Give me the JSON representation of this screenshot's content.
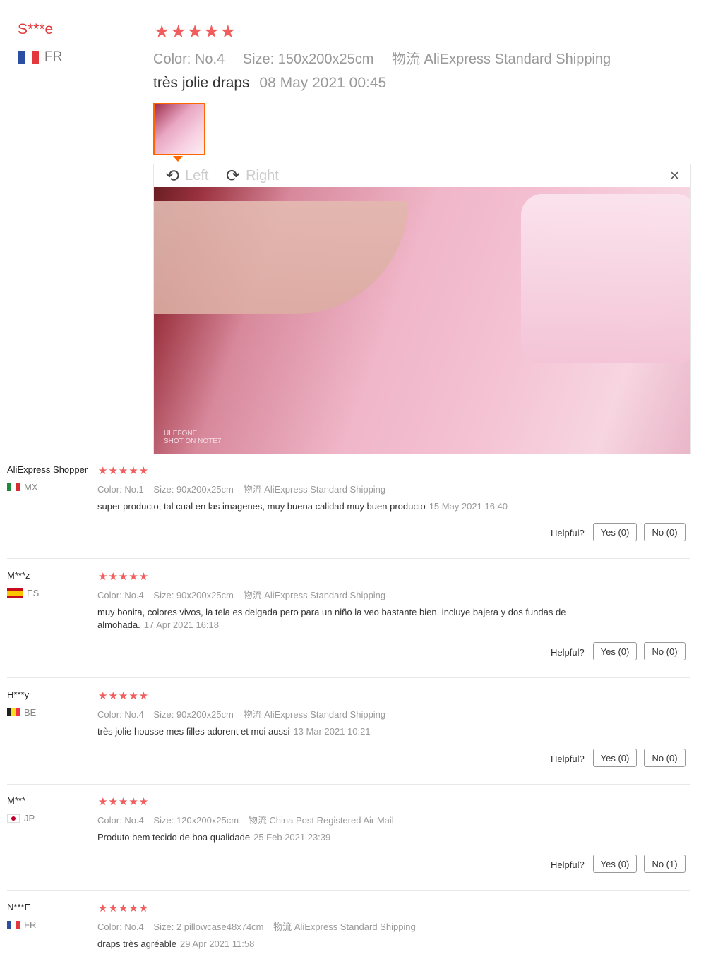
{
  "featured": {
    "name": "S***e",
    "country": "FR",
    "stars": "★★★★★",
    "color_label": "Color:",
    "color_value": "No.4",
    "size_label": "Size:",
    "size_value": "150x200x25cm",
    "shipping_label": "物流",
    "shipping_value": "AliExpress Standard Shipping",
    "text": "très jolie draps",
    "date": "08 May 2021 00:45",
    "viewer": {
      "rotate_left": "Left",
      "rotate_right": "Right",
      "close": "×",
      "watermark_line1": "ULEFONE",
      "watermark_line2": "SHOT ON NOTE7"
    }
  },
  "reviews": [
    {
      "name": "AliExpress Shopper",
      "country": "MX",
      "stars": "★★★★★",
      "color_label": "Color:",
      "color_value": "No.1",
      "size_label": "Size:",
      "size_value": "90x200x25cm",
      "shipping_label": "物流",
      "shipping_value": "AliExpress Standard Shipping",
      "text": "super producto, tal cual en las imagenes, muy buena calidad muy buen producto",
      "date": "15 May 2021 16:40",
      "helpful": "Helpful?",
      "yes": "Yes (0)",
      "no": "No (0)"
    },
    {
      "name": "M***z",
      "country": "ES",
      "stars": "★★★★★",
      "color_label": "Color:",
      "color_value": "No.4",
      "size_label": "Size:",
      "size_value": "90x200x25cm",
      "shipping_label": "物流",
      "shipping_value": "AliExpress Standard Shipping",
      "text": "muy bonita, colores vivos, la tela es delgada pero para un niño la veo bastante bien, incluye bajera y dos fundas de almohada.",
      "date": "17 Apr 2021 16:18",
      "helpful": "Helpful?",
      "yes": "Yes (0)",
      "no": "No (0)"
    },
    {
      "name": "H***y",
      "country": "BE",
      "stars": "★★★★★",
      "color_label": "Color:",
      "color_value": "No.4",
      "size_label": "Size:",
      "size_value": "90x200x25cm",
      "shipping_label": "物流",
      "shipping_value": "AliExpress Standard Shipping",
      "text": "très jolie housse mes filles adorent et moi aussi",
      "date": "13 Mar 2021 10:21",
      "helpful": "Helpful?",
      "yes": "Yes (0)",
      "no": "No (0)"
    },
    {
      "name": "M***",
      "country": "JP",
      "stars": "★★★★★",
      "color_label": "Color:",
      "color_value": "No.4",
      "size_label": "Size:",
      "size_value": "120x200x25cm",
      "shipping_label": "物流",
      "shipping_value": "China Post Registered Air Mail",
      "text": "Produto bem tecido de boa qualidade",
      "date": "25 Feb 2021 23:39",
      "helpful": "Helpful?",
      "yes": "Yes (0)",
      "no": "No (1)"
    },
    {
      "name": "N***E",
      "country": "FR",
      "stars": "★★★★★",
      "color_label": "Color:",
      "color_value": "No.4",
      "size_label": "Size:",
      "size_value": "2 pillowcase48x74cm",
      "shipping_label": "物流",
      "shipping_value": "AliExpress Standard Shipping",
      "text": "draps très agréable",
      "date": "29 Apr 2021 11:58"
    }
  ],
  "colors": {
    "star": "#f15c5c",
    "highlight_border": "#ff6600",
    "name_red": "#e4393c"
  }
}
